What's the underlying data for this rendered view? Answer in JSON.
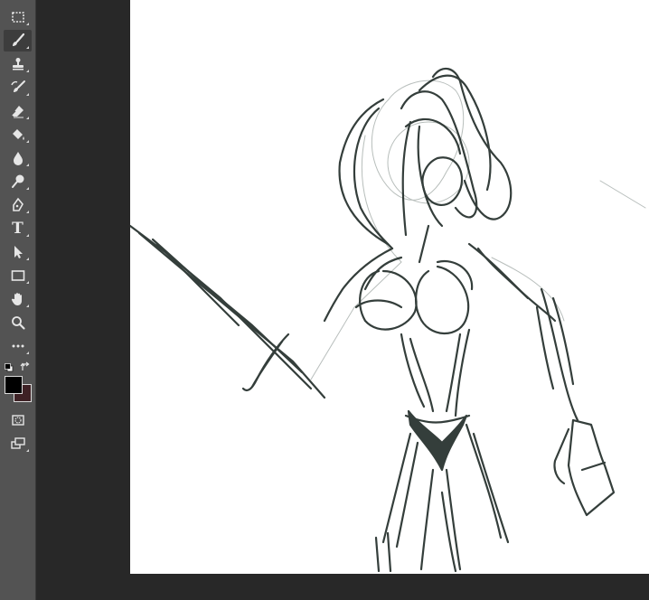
{
  "toolbar": {
    "tools": [
      {
        "id": "marquee",
        "icon": "marquee-icon"
      },
      {
        "id": "brush",
        "icon": "brush-icon",
        "active": true
      },
      {
        "id": "stamp",
        "icon": "clone-stamp-icon"
      },
      {
        "id": "history-brush",
        "icon": "history-brush-icon"
      },
      {
        "id": "eraser",
        "icon": "eraser-icon"
      },
      {
        "id": "bucket",
        "icon": "paint-bucket-icon"
      },
      {
        "id": "blur",
        "icon": "blur-drop-icon"
      },
      {
        "id": "dodge",
        "icon": "dodge-icon"
      },
      {
        "id": "pen",
        "icon": "pen-icon"
      },
      {
        "id": "type",
        "icon": "type-icon",
        "glyph": "T"
      },
      {
        "id": "path-select",
        "icon": "path-selection-icon"
      },
      {
        "id": "rectangle",
        "icon": "rectangle-icon"
      },
      {
        "id": "hand",
        "icon": "hand-icon"
      },
      {
        "id": "zoom",
        "icon": "zoom-icon"
      },
      {
        "id": "more",
        "icon": "more-icon"
      }
    ],
    "colors": {
      "foreground": "#000000",
      "background": "#3e2125"
    }
  },
  "canvas": {
    "background": "#ffffff",
    "stroke_color": "#1f2a26"
  }
}
